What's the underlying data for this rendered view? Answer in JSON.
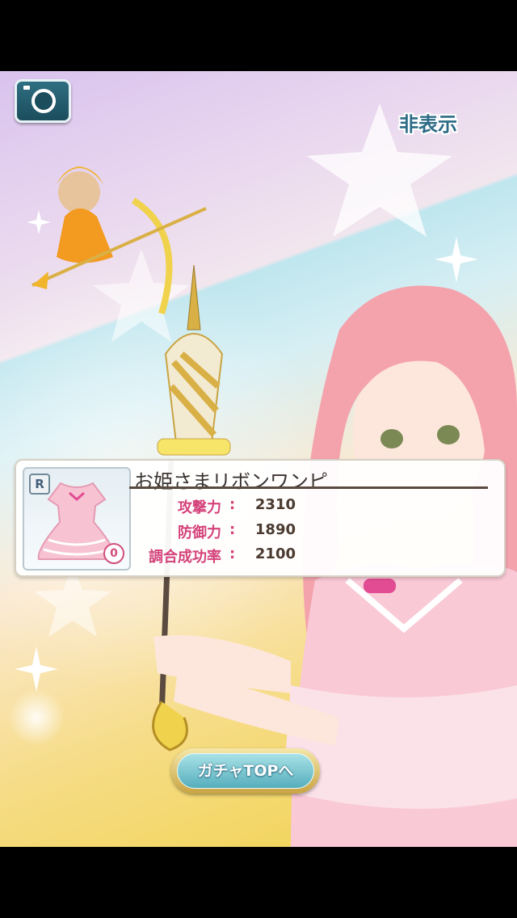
{
  "top_bar": {
    "hide_label": "非表示",
    "camera_icon": "camera-icon"
  },
  "item": {
    "rarity": "R",
    "plus_level": "0",
    "name": "お姫さまリボンワンピ",
    "stats": [
      {
        "label": "攻撃力",
        "colon": ":",
        "value": "2310"
      },
      {
        "label": "防御力",
        "colon": ":",
        "value": "1890"
      },
      {
        "label": "調合成功率",
        "colon": ":",
        "value": "2100"
      }
    ]
  },
  "buttons": {
    "gacha_top": "ガチャTOPへ"
  },
  "colors": {
    "accent_pink": "#d4427a",
    "button_teal": "#56aebd",
    "frame_gold": "#c9a443"
  }
}
